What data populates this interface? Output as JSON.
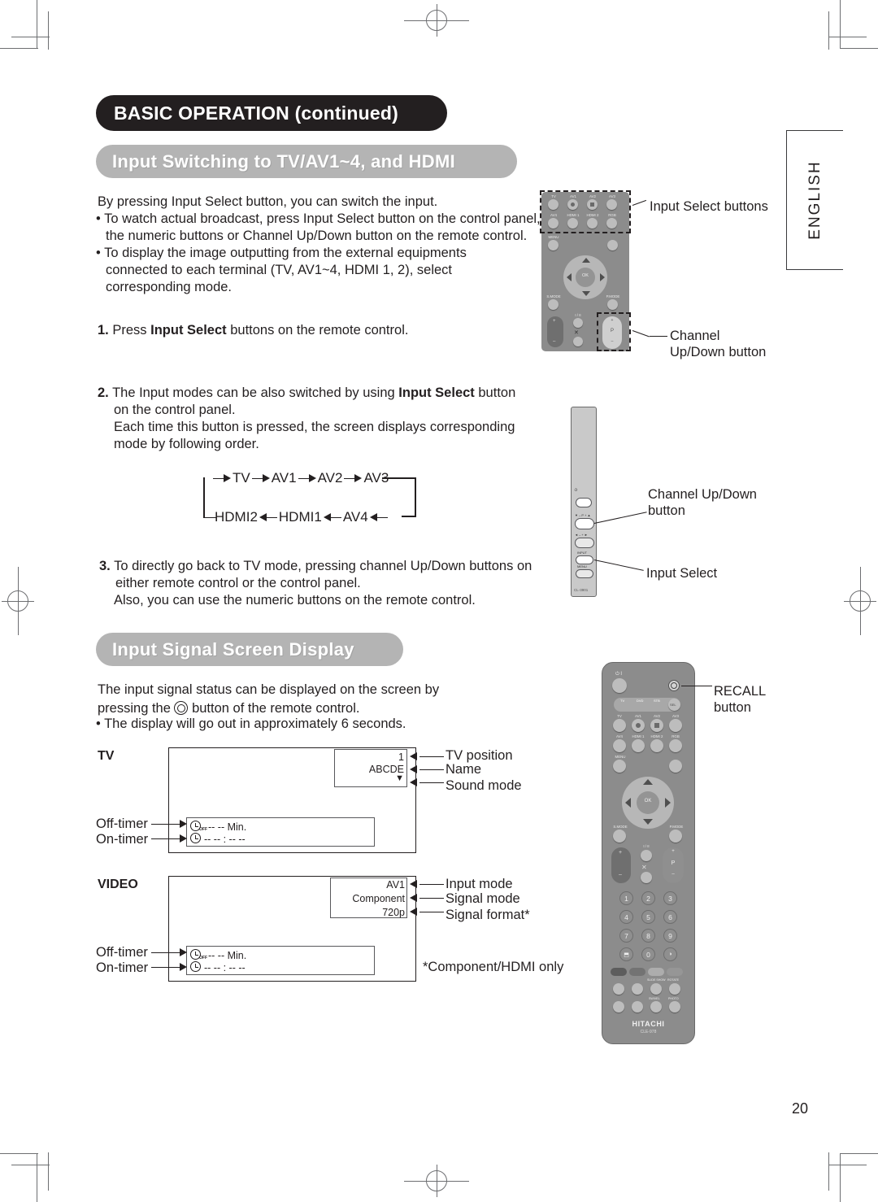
{
  "page": {
    "number": "20",
    "language_tab": "ENGLISH"
  },
  "headings": {
    "chapter": "BASIC OPERATION (continued)",
    "section1": "Input Switching to TV/AV1~4, and HDMI",
    "section2": "Input Signal Screen Display"
  },
  "intro": {
    "line1": "By pressing Input Select button, you can switch the input.",
    "bullet1_l1": "• To watch actual broadcast, press Input Select button on the control panel,",
    "bullet1_l2": "the numeric buttons or Channel Up/Down button on the remote control.",
    "bullet2_l1": "• To display the image outputting from the external equipments",
    "bullet2_l2": "connected to each terminal (TV, AV1~4, HDMI 1, 2), select",
    "bullet2_l3": "corresponding mode."
  },
  "steps": [
    {
      "number": "1.",
      "lines": [
        "Press |Input Select| buttons on the remote control."
      ]
    },
    {
      "number": "2.",
      "lines": [
        "The Input modes can be also switched by using |Input Select| button",
        "on the control panel.",
        "Each time this button is pressed, the screen displays corresponding",
        "mode by following order."
      ]
    },
    {
      "number": "3.",
      "lines": [
        "To directly go back to TV mode, pressing channel Up/Down buttons on",
        "either remote control or the control panel.",
        "Also, you can use the numeric buttons on the remote control."
      ]
    }
  ],
  "step1_text_a": "Press ",
  "step1_text_b": "Input Select",
  "step1_text_c": " buttons on the remote control.",
  "step2_a": "The Input modes can be also switched by using ",
  "step2_b": "Input Select",
  "step2_c": " button",
  "step2_l2": "on the control panel.",
  "step2_l3": "Each time this button is pressed, the screen displays corresponding",
  "step2_l4": "mode by following order.",
  "step3_l1": "To directly go back to TV mode, pressing channel Up/Down buttons on",
  "step3_l2": "either remote control or the control panel.",
  "step3_l3": "Also, you can use the numeric buttons on the remote control.",
  "flow": {
    "top": [
      "TV",
      "AV1",
      "AV2",
      "AV3"
    ],
    "bottom": [
      "HDMI2",
      "HDMI1",
      "AV4"
    ]
  },
  "signal_section": {
    "line1": "The input signal status can be displayed on the screen by",
    "line2_a": "pressing the ",
    "line2_b": " button of the remote control.",
    "bullet": "• The display will go out in approximately 6 seconds."
  },
  "osd_tv": {
    "label": "TV",
    "position_value": "1",
    "name_value": "ABCDE",
    "sound_mode_value": "▼",
    "off_timer_value": "-- -- Min.",
    "on_timer_value": "-- -- : -- --",
    "callouts": {
      "position": "TV position",
      "name": "Name",
      "sound_mode": "Sound mode",
      "off_timer": "Off-timer",
      "on_timer": "On-timer"
    }
  },
  "osd_video": {
    "label": "VIDEO",
    "input_mode_value": "AV1",
    "signal_mode_value": "Component",
    "signal_format_value": "720p",
    "off_timer_value": "-- -- Min.",
    "on_timer_value": "-- -- : -- --",
    "callouts": {
      "input_mode": "Input mode",
      "signal_mode": "Signal mode",
      "signal_format": "Signal format*",
      "off_timer": "Off-timer",
      "on_timer": "On-timer",
      "footnote": "*Component/HDMI only"
    }
  },
  "figure_callouts": {
    "input_select_buttons": "Input Select buttons",
    "channel_updown_l1": "Channel",
    "channel_updown_l2": "Up/Down button",
    "panel_channel_l1": "Channel Up/Down",
    "panel_channel_l2": "button",
    "panel_input_select": "Input Select",
    "recall_l1": "RECALL",
    "recall_l2": "button"
  },
  "remote_small": {
    "input_row1": [
      "TV",
      "AV1",
      "AV2",
      "AV3"
    ],
    "input_row2": [
      "AV4",
      "HDMI 1",
      "HDMI 2",
      "RGB"
    ],
    "menu_label": "MENU",
    "ok_label": "OK",
    "smode_label": "S.MODE",
    "pmode_label": "P.MODE",
    "io_label": "I / II",
    "channel_letter": "P",
    "channel_plus": "+",
    "channel_minus": "–"
  },
  "panel": {
    "power_label": "⏻",
    "channel_label": "▼ –   P   + ▲",
    "volume_label": "◄ –      + ►",
    "input_label": "INPUT",
    "menu_label": "MENU",
    "model_code": "CL-3901"
  },
  "remote_large": {
    "power_label": "⏻ I",
    "recall_icon": "recall",
    "device_labels": [
      "TV",
      "DVD",
      "STB"
    ],
    "sel_label": "SEL",
    "input_row1": [
      "TV",
      "AV1",
      "AV2",
      "AV3"
    ],
    "input_row2": [
      "AV4",
      "HDMI 1",
      "HDMI 2",
      "RGB"
    ],
    "menu_label": "MENU",
    "ok_label": "OK",
    "smode_label": "S.MODE",
    "pmode_label": "P.MODE",
    "io_label": "I / II",
    "channel_letter": "P",
    "numbers": [
      "1",
      "2",
      "3",
      "4",
      "5",
      "6",
      "7",
      "8",
      "9",
      "⬒",
      "0",
      "◑"
    ],
    "slide_show_label": "SLIDE SHOW",
    "rotate_label": "ROTATE",
    "swivel_label": "SWIVEL",
    "photo_label": "PHOTO",
    "brand": "HITACHI",
    "model": "CLE-978"
  },
  "colors": {
    "heading_dark": "#231f20",
    "heading_gray": "#b4b4b4",
    "remote_body": "#8c8c8c",
    "text": "#231f20"
  }
}
